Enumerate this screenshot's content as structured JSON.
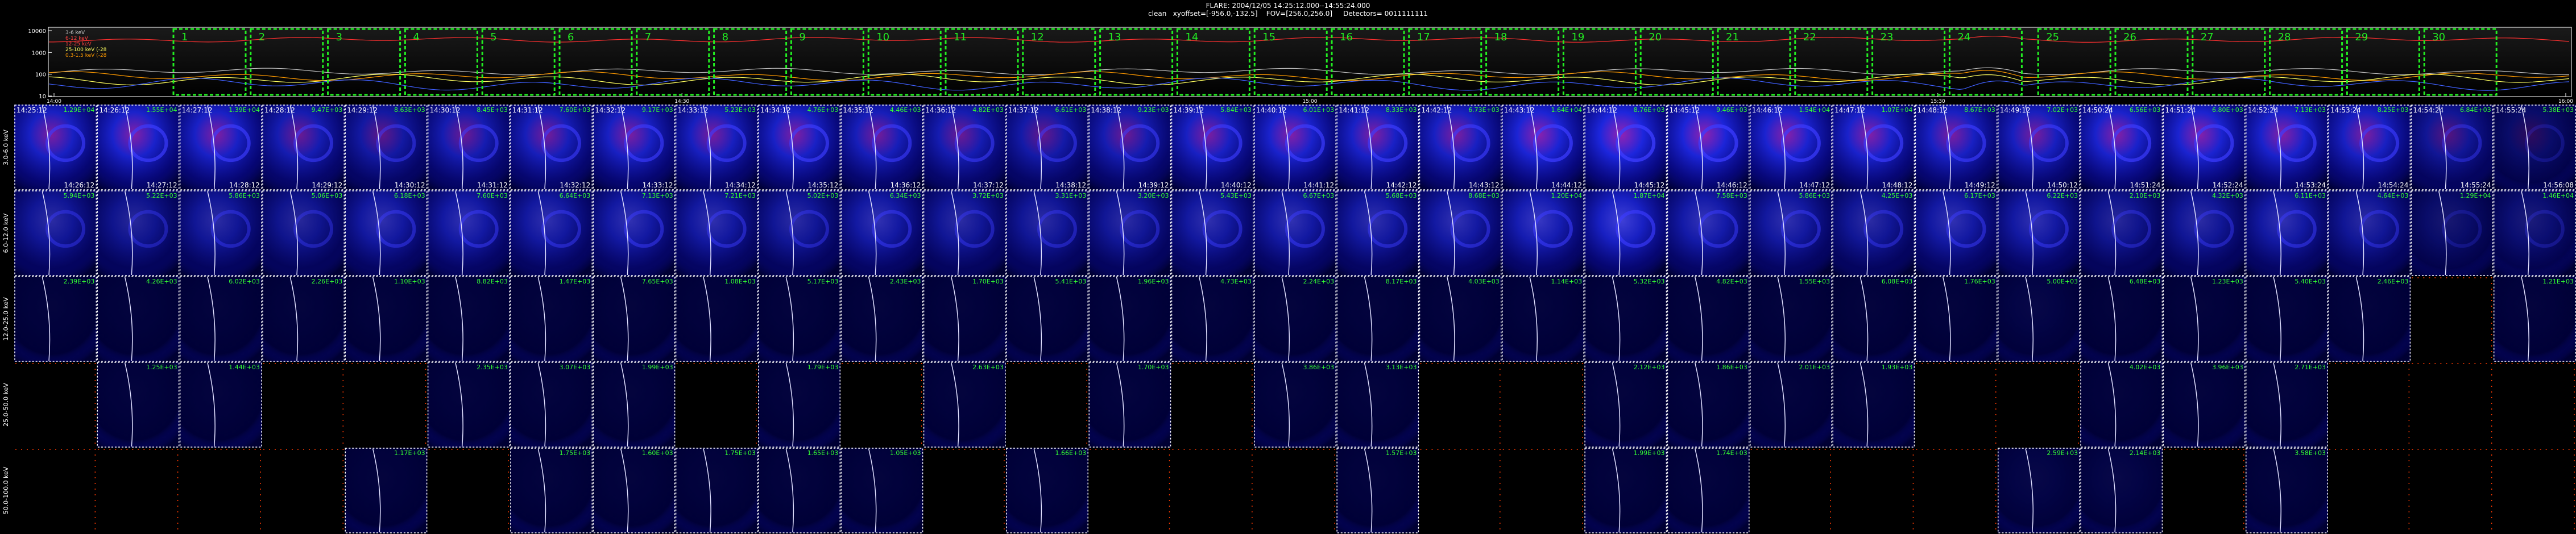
{
  "header": {
    "line1": "FLARE: 2004/12/05 14:25:12.000--14:55:24.000",
    "line2": "clean   xyoffset=[-956.0,-132.5]    FOV=[256.0,256.0]     Detectors= 0011111111"
  },
  "lightcurve": {
    "y_ticks": [
      "10000",
      "1000",
      "100",
      "10"
    ],
    "x_ticks": [
      "14:00",
      "14:30",
      "15:00",
      "15:30",
      "16:00"
    ],
    "legend": [
      {
        "label": "3-6 keV",
        "color": "#cfcfcf"
      },
      {
        "label": "6-12 keV",
        "color": "#ff4040"
      },
      {
        "label": "12-25 keV",
        "color": "#ff4040"
      },
      {
        "label": "25-100 keV (-28",
        "color": "#ffff60"
      },
      {
        "label": "0.3-1.5 keV (-28",
        "color": "#ff9a00"
      }
    ],
    "interval_numbers": [
      "1",
      "2",
      "3",
      "4",
      "5",
      "6",
      "7",
      "8",
      "9",
      "10",
      "11",
      "12",
      "13",
      "14",
      "15",
      "16",
      "17",
      "18",
      "19",
      "20",
      "21",
      "22",
      "23",
      "24",
      "25",
      "26",
      "27",
      "28",
      "29",
      "30"
    ],
    "colors": {
      "interval_box": "#22ee22",
      "axis": "#ffffff"
    }
  },
  "grid": {
    "row_labels": [
      "3.0-6.0 keV",
      "6.0-12.0 keV",
      "12.0-25.0 keV",
      "25.0-50.0 keV",
      "50.0-100.0 keV"
    ],
    "start_times": [
      "14:25:12",
      "14:26:12",
      "14:27:12",
      "14:28:12",
      "14:29:12",
      "14:30:12",
      "14:31:12",
      "14:32:12",
      "14:33:12",
      "14:34:12",
      "14:35:12",
      "14:36:12",
      "14:37:12",
      "14:38:12",
      "14:39:12",
      "14:40:12",
      "14:41:12",
      "14:42:12",
      "14:43:12",
      "14:44:12",
      "14:45:12",
      "14:46:12",
      "14:47:12",
      "14:48:12",
      "14:49:12",
      "14:50:24",
      "14:51:24",
      "14:52:24",
      "14:53:24",
      "14:54:24",
      "14:55:24"
    ],
    "end_times": [
      "14:26:12",
      "14:27:12",
      "14:28:12",
      "14:29:12",
      "14:30:12",
      "14:31:12",
      "14:32:12",
      "14:33:12",
      "14:34:12",
      "14:35:12",
      "14:36:12",
      "14:37:12",
      "14:38:12",
      "14:39:12",
      "14:40:12",
      "14:41:12",
      "14:42:12",
      "14:43:12",
      "14:44:12",
      "14:45:12",
      "14:46:12",
      "14:47:12",
      "14:48:12",
      "14:49:12",
      "14:50:12",
      "14:51:24",
      "14:52:24",
      "14:53:24",
      "14:54:24",
      "14:55:24",
      "14:56:08"
    ],
    "row0_values": [
      "1.29E+04",
      "1.55E+04",
      "1.39E+04",
      "9.47E+03",
      "8.63E+03",
      "8.45E+03",
      "7.60E+03",
      "9.17E+03",
      "5.23E+03",
      "4.76E+03",
      "4.46E+03",
      "4.82E+03",
      "6.61E+03",
      "9.23E+03",
      "5.84E+03",
      "6.01E+03",
      "8.33E+03",
      "6.73E+03",
      "1.64E+04",
      "8.76E+03",
      "9.46E+03",
      "1.54E+04",
      "1.07E+04",
      "8.67E+03",
      "7.02E+03",
      "6.56E+03",
      "6.80E+03",
      "7.13E+03",
      "8.25E+03",
      "6.84E+03",
      "5.38E+03"
    ],
    "row1_values": [
      "5.94E+03",
      "5.22E+03",
      "5.86E+03",
      "5.06E+03",
      "6.18E+03",
      "7.60E+03",
      "6.64E+03",
      "7.13E+03",
      "7.21E+03",
      "5.02E+03",
      "6.34E+03",
      "3.72E+03",
      "3.31E+03",
      "3.20E+03",
      "5.43E+03",
      "6.67E+03",
      "5.68E+03",
      "8.68E+03",
      "1.20E+04",
      "1.87E+04",
      "7.58E+03",
      "5.86E+03",
      "4.25E+03",
      "6.17E+03",
      "6.22E+03",
      "2.10E+03",
      "4.32E+03",
      "6.11E+03",
      "4.64E+03",
      "1.29E+04",
      "1.46E+04"
    ],
    "row2_values": [
      "2.39E+03",
      "4.26E+03",
      "6.02E+03",
      "2.26E+03",
      "1.10E+03",
      "8.82E+03",
      "1.47E+03",
      "7.65E+03",
      "1.08E+03",
      "5.17E+03",
      "2.43E+03",
      "1.70E+03",
      "5.41E+03",
      "1.96E+03",
      "4.73E+03",
      "2.24E+03",
      "8.17E+03",
      "4.03E+03",
      "1.14E+03",
      "5.32E+03",
      "4.82E+03",
      "1.55E+03",
      "6.08E+03",
      "1.76E+03",
      "5.00E+03",
      "6.48E+03",
      "1.23E+03",
      "5.40E+03",
      "2.46E+03",
      "",
      "1.21E+03"
    ],
    "row3_values": [
      "",
      "1.25E+03",
      "1.44E+03",
      "",
      "",
      "2.35E+03",
      "3.07E+03",
      "1.99E+03",
      "",
      "1.79E+03",
      "",
      "2.63E+03",
      "",
      "1.70E+03",
      "",
      "3.86E+03",
      "3.13E+03",
      "",
      "",
      "2.12E+03",
      "1.86E+03",
      "2.01E+03",
      "1.93E+03",
      "",
      "",
      "4.02E+03",
      "3.96E+03",
      "2.71E+03",
      "",
      "",
      ""
    ],
    "row4_values": [
      "",
      "",
      "",
      "",
      "1.17E+03",
      "",
      "1.75E+03",
      "1.60E+03",
      "1.75E+03",
      "1.65E+03",
      "1.05E+03",
      "",
      "1.66E+03",
      "",
      "",
      "",
      "1.57E+03",
      "",
      "",
      "1.99E+03",
      "1.74E+03",
      "",
      "",
      "",
      "2.59E+03",
      "2.14E+03",
      "",
      "3.58E+03",
      "",
      "",
      ""
    ],
    "row_thresholds": [
      0,
      0,
      1,
      2,
      3
    ],
    "row_intensities": [
      [
        0.8,
        0.85,
        0.82,
        0.7,
        0.62,
        0.7,
        0.75,
        0.8,
        0.78,
        0.82,
        0.75,
        0.7,
        0.65,
        0.7,
        0.8,
        0.85,
        0.82,
        0.8,
        0.9,
        0.95,
        0.92,
        0.88,
        0.85,
        0.8,
        0.78,
        0.85,
        0.88,
        0.85,
        0.8,
        0.55,
        0.3
      ],
      [
        0.55,
        0.5,
        0.55,
        0.5,
        0.6,
        0.62,
        0.6,
        0.62,
        0.6,
        0.55,
        0.62,
        0.55,
        0.55,
        0.55,
        0.6,
        0.62,
        0.6,
        0.62,
        0.7,
        0.8,
        0.65,
        0.6,
        0.55,
        0.62,
        0.62,
        0.5,
        0.55,
        0.62,
        0.55,
        0.3,
        0.35
      ],
      [
        0.05,
        0.05,
        0.05,
        0.05,
        0.05,
        0.05,
        0.05,
        0.05,
        0.05,
        0.05,
        0.05,
        0.05,
        0.05,
        0.05,
        0.05,
        0.05,
        0.05,
        0.05,
        0.05,
        0.05,
        0.05,
        0.05,
        0.05,
        0.05,
        0.1,
        0.05,
        0.05,
        0.05,
        0.05,
        0.0,
        0.05
      ],
      [
        0.0,
        0.05,
        0.05,
        0.0,
        0.0,
        0.05,
        0.05,
        0.05,
        0.0,
        0.05,
        0.0,
        0.05,
        0.0,
        0.05,
        0.0,
        0.05,
        0.05,
        0.0,
        0.0,
        0.05,
        0.05,
        0.05,
        0.05,
        0.0,
        0.0,
        0.05,
        0.05,
        0.05,
        0.0,
        0.0,
        0.0
      ],
      [
        0.0,
        0.0,
        0.0,
        0.0,
        0.05,
        0.0,
        0.05,
        0.05,
        0.05,
        0.05,
        0.05,
        0.0,
        0.05,
        0.0,
        0.0,
        0.0,
        0.05,
        0.0,
        0.0,
        0.05,
        0.05,
        0.0,
        0.0,
        0.0,
        0.1,
        0.1,
        0.0,
        0.05,
        0.0,
        0.0,
        0.0
      ]
    ],
    "colors": {
      "panel_bg": "#000033",
      "border": "#ffffff",
      "empty_axis": "#ff3a00",
      "time_text": "#ffffff",
      "value_text": "#33ff33",
      "limb": "#e0e0ff"
    }
  }
}
